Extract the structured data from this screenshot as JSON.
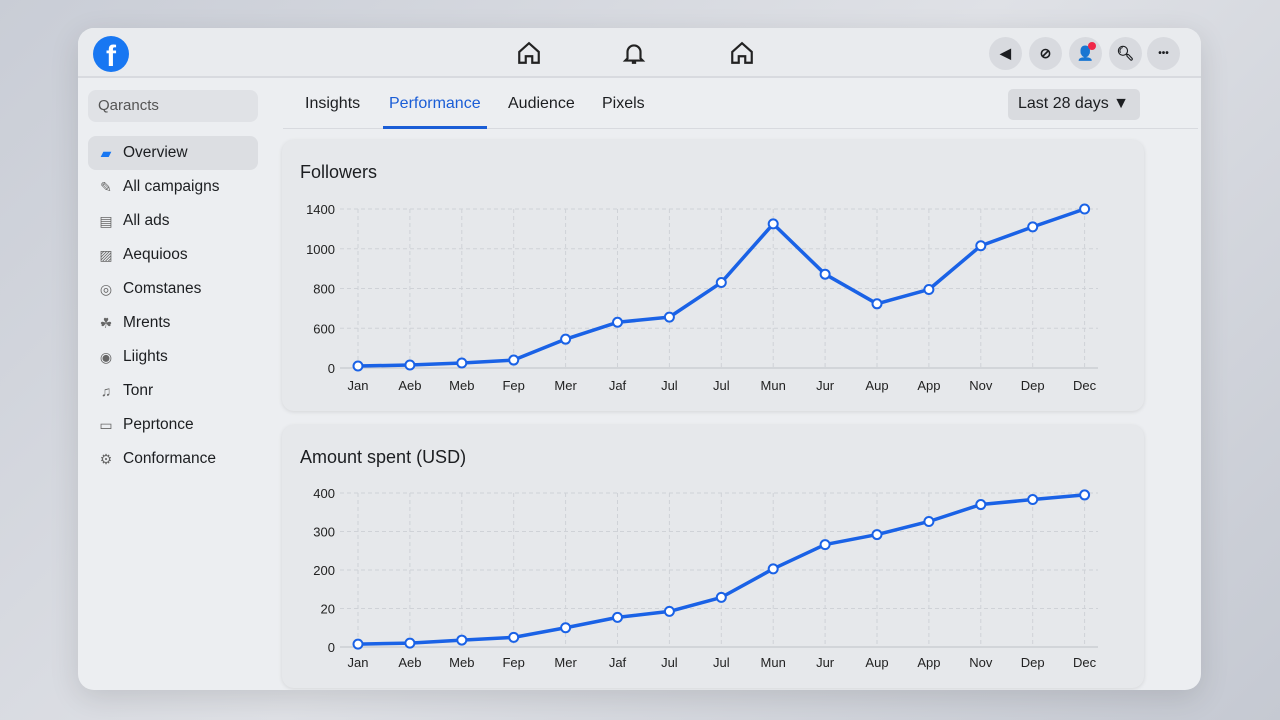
{
  "topbar": {
    "logo": "f",
    "nav_icons": [
      "home-icon",
      "bell-icon",
      "home-icon"
    ],
    "right_icons": [
      "back-icon",
      "messenger-icon",
      "friends-icon",
      "search-icon",
      "more-icon"
    ],
    "more_label": "•••"
  },
  "sidebar": {
    "search_placeholder": "Qarancts",
    "items": [
      {
        "label": "Overview",
        "icon": "▰"
      },
      {
        "label": "All campaigns",
        "icon": "✎"
      },
      {
        "label": "All ads",
        "icon": "▤"
      },
      {
        "label": "Aequioos",
        "icon": "▨"
      },
      {
        "label": "Comstanes",
        "icon": "◎"
      },
      {
        "label": "Mrents",
        "icon": "☘"
      },
      {
        "label": "Liights",
        "icon": "◉"
      },
      {
        "label": "Tonr",
        "icon": "♫"
      },
      {
        "label": "Peprtonce",
        "icon": "▭"
      },
      {
        "label": "Conformance",
        "icon": "⚙"
      }
    ]
  },
  "tabs": [
    "Insights",
    "Performance",
    "Audience",
    "Pixels"
  ],
  "date_range": "Last 28 days ▼",
  "accent": "#1a62e6",
  "chart_data": [
    {
      "type": "line",
      "title": "Followers",
      "ytick_labels": [
        0,
        600,
        800,
        1000,
        1400
      ],
      "categories": [
        "Jan",
        "Aeb",
        "Meb",
        "Fep",
        "Mer",
        "Jaf",
        "Jul",
        "Jul",
        "Mun",
        "Jur",
        "Aup",
        "App",
        "Nov",
        "Dep",
        "Dec"
      ],
      "values": [
        30,
        45,
        75,
        120,
        435,
        630,
        656,
        830,
        1250,
        872,
        723,
        795,
        1030,
        1220,
        1400
      ]
    },
    {
      "type": "line",
      "title": "Amount spent (USD)",
      "ytick_labels": [
        0,
        20,
        200,
        300,
        400
      ],
      "categories": [
        "Jan",
        "Aeb",
        "Meb",
        "Fep",
        "Mer",
        "Jaf",
        "Jul",
        "Jul",
        "Mun",
        "Jur",
        "Aup",
        "App",
        "Nov",
        "Dep",
        "Dec"
      ],
      "values": [
        1.5,
        2,
        3.6,
        5,
        10,
        15.4,
        18.5,
        72,
        203,
        266,
        292,
        326,
        370,
        383,
        395
      ]
    }
  ]
}
